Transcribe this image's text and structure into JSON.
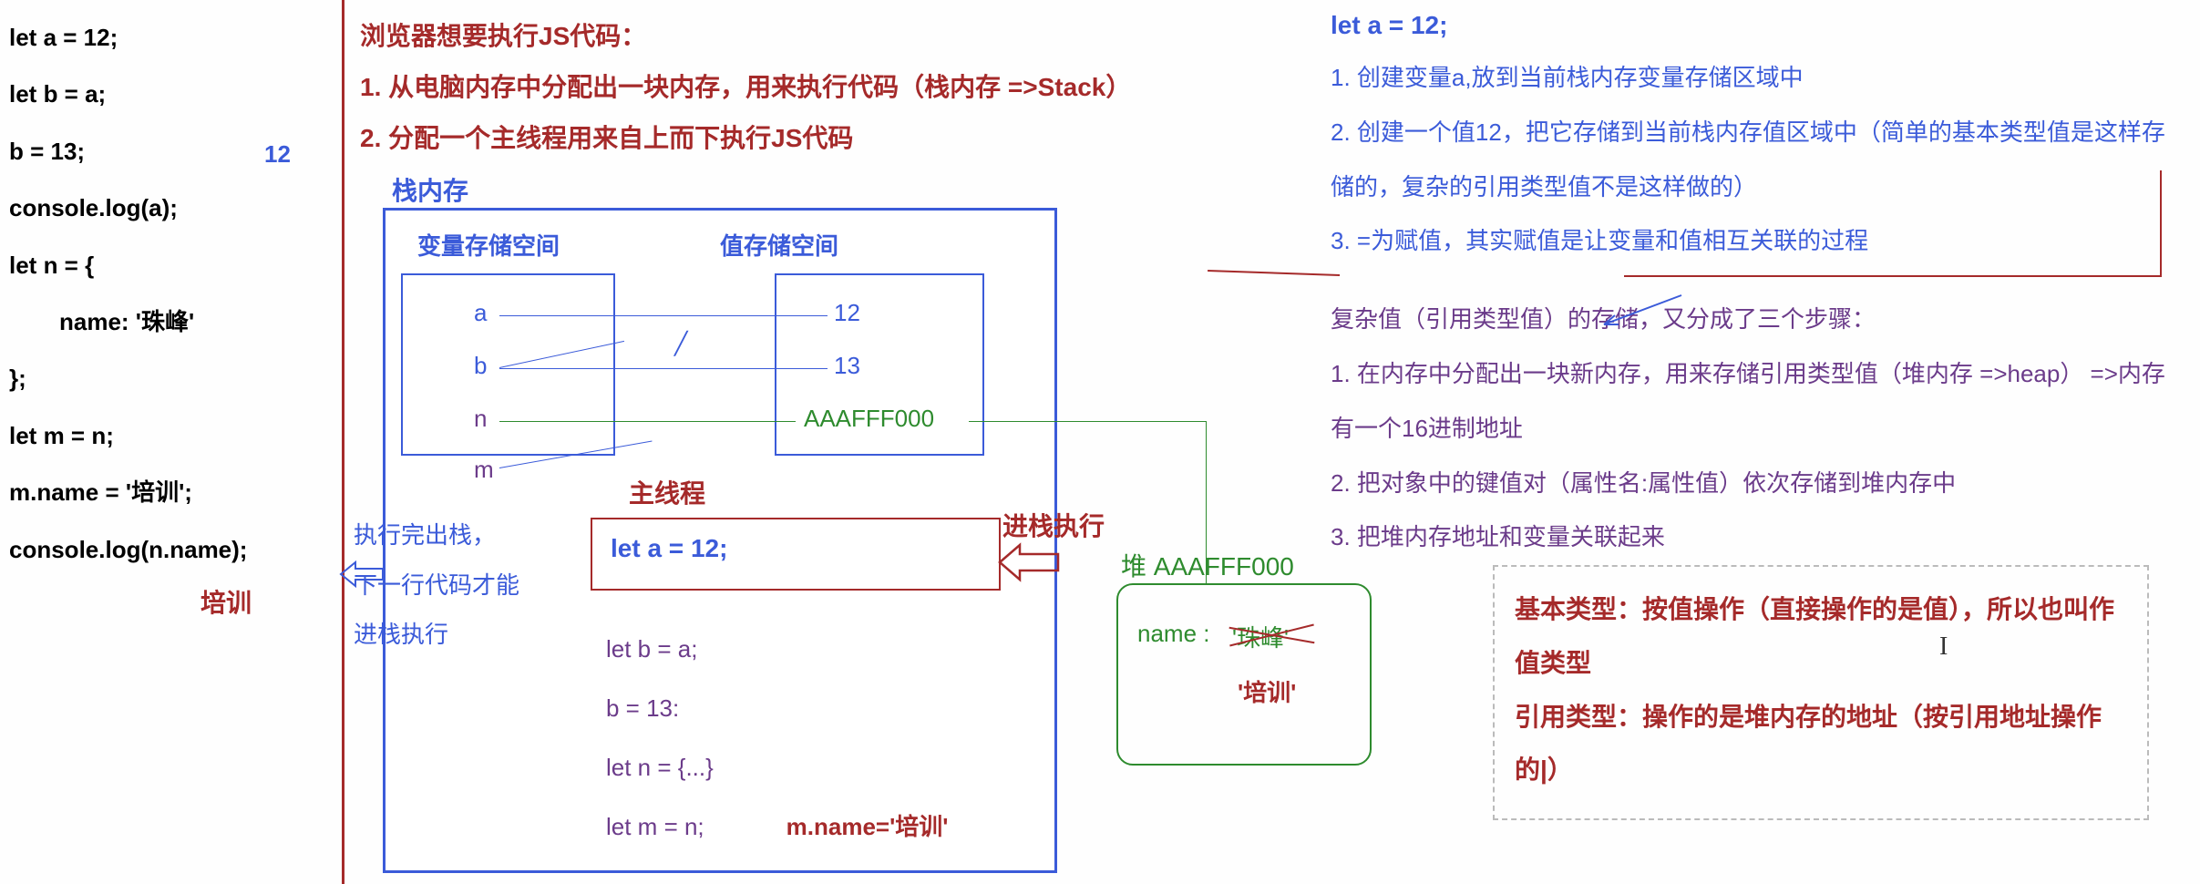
{
  "leftCode": {
    "l1": "let a = 12;",
    "l2": "let b = a;",
    "l3": "b = 13;",
    "l4": "console.log(a);",
    "r4": "12",
    "l5": "let n = {",
    "l6": "name: '珠峰'",
    "l7": "};",
    "l8": "let m = n;",
    "l9": "m.name = '培训';",
    "l10": "console.log(n.name);",
    "r10": "培训"
  },
  "midHeader": {
    "title": "浏览器想要执行JS代码：",
    "step1": "1. 从电脑内存中分配出一块内存，用来执行代码（栈内存 =>Stack）",
    "step2": "2. 分配一个主线程用来自上而下执行JS代码"
  },
  "stack": {
    "label": "栈内存",
    "varHeader": "变量存储空间",
    "valHeader": "值存储空间",
    "vars": [
      "a",
      "b",
      "n",
      "m"
    ],
    "vals": [
      "12",
      "13"
    ],
    "addr": "AAAFFF000",
    "mainthread": "主线程",
    "execMain": "let  a = 12;",
    "queue": {
      "q1": "let b = a;",
      "q2": "b = 13:",
      "q3": "let n = {...}",
      "q4": "let m = n;",
      "mname": "m.name='培训'"
    },
    "pushLabel": "进栈执行",
    "popText1": "执行完出栈，",
    "popText2": "下一行代码才能",
    "popText3": "进栈执行"
  },
  "heap": {
    "label": "堆 AAAFFF000",
    "nameKey": "name :",
    "oldVal": "'珠峰'",
    "newVal": "'培训'"
  },
  "right": {
    "title": "let a = 12;",
    "b1": "1. 创建变量a,放到当前栈内存变量存储区域中",
    "b2": "2. 创建一个值12，把它存储到当前栈内存值区域中（简单的基本类型值是这样存储的，复杂的引用类型值不是这样做的）",
    "b3": "3. =为赋值，其实赋值是让变量和值相互关联的过程",
    "p0": "复杂值（引用类型值）的存储，又分成了三个步骤：",
    "p1": "1. 在内存中分配出一块新内存，用来存储引用类型值（堆内存 =>heap）  =>内存有一个16进制地址",
    "p2": "2. 把对象中的键值对（属性名:属性值）依次存储到堆内存中",
    "p3": "3. 把堆内存地址和变量关联起来"
  },
  "summary": {
    "s1": "基本类型：按值操作（直接操作的是值），所以也叫作值类型",
    "s2": "引用类型：操作的是堆内存的地址（按引用地址操作的|）"
  },
  "cursor": "I"
}
